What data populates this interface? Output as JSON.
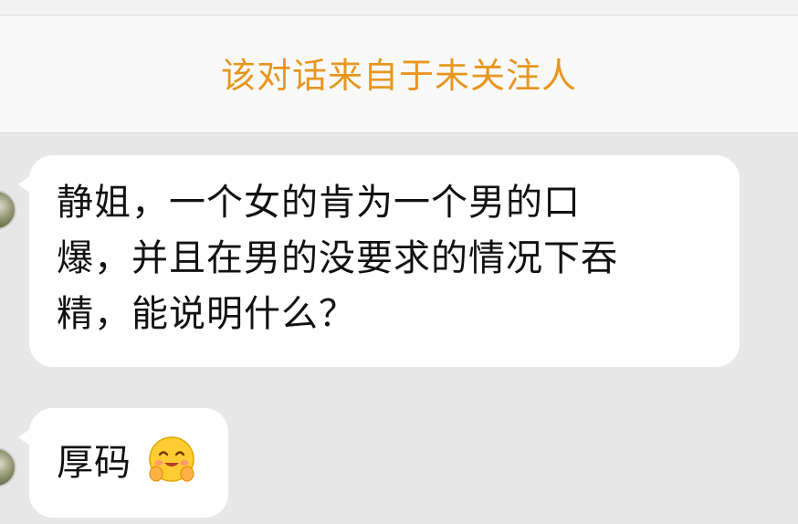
{
  "notice": {
    "text": "该对话来自于未关注人"
  },
  "messages": [
    {
      "text": "静姐，一个女的肯为一个男的口\n爆，并且在男的没要求的情况下吞\n精，能说明什么？"
    },
    {
      "text": "厚码",
      "emoji": "hug-smiling-face-emoji"
    }
  ],
  "colors": {
    "notice_text": "#e8961e",
    "chat_background": "#e7e7e7",
    "bubble": "#ffffff"
  }
}
